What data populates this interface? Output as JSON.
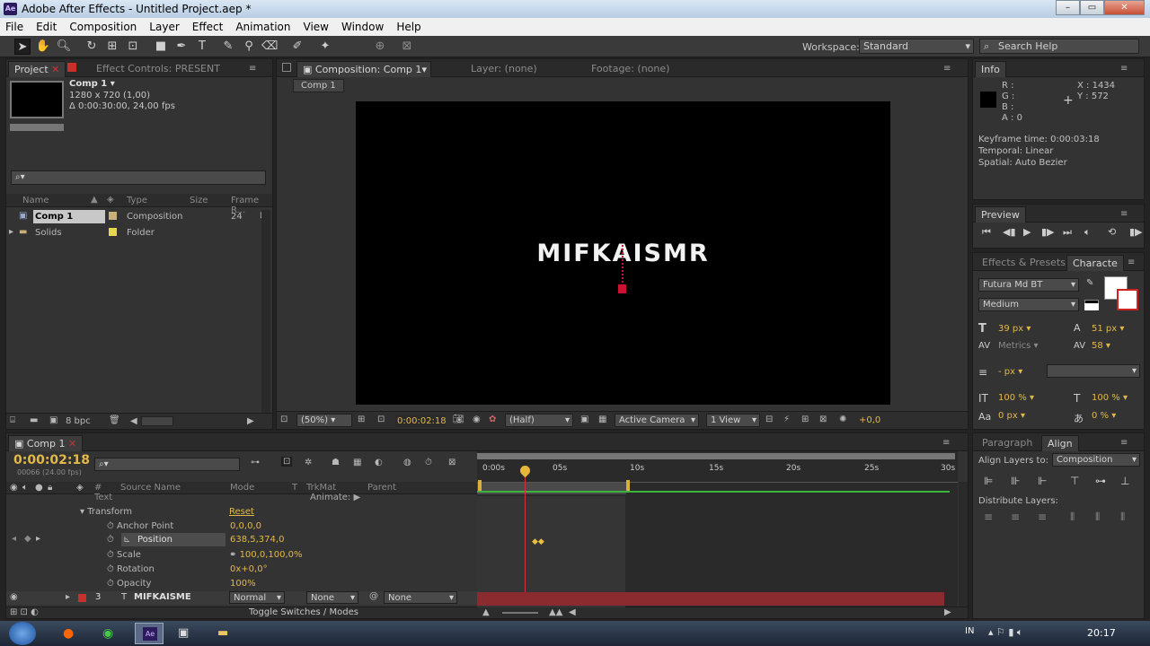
{
  "window": {
    "title": "Adobe After Effects - Untitled Project.aep *",
    "logo": "Ae",
    "min": "–",
    "max": "▭",
    "close": "✕"
  },
  "menu": [
    "File",
    "Edit",
    "Composition",
    "Layer",
    "Effect",
    "Animation",
    "View",
    "Window",
    "Help"
  ],
  "toolbar": {
    "workspace_label": "Workspace:",
    "workspace_value": "Standard",
    "search_placeholder": "Search Help"
  },
  "project": {
    "tab_project": "Project",
    "tab_effect": "Effect Controls: PRESENT",
    "comp_name": "Comp 1 ▾",
    "comp_size": "1280 x 720 (1,00)",
    "comp_duration": "Δ 0:00:30:00, 24,00 fps",
    "search_placeholder": "",
    "headers": {
      "name": "Name",
      "type": "Type",
      "size": "Size",
      "framerate": "Frame R..."
    },
    "items": [
      {
        "name": "Comp 1",
        "type": "Composition",
        "framerate": "24"
      },
      {
        "name": "Solids",
        "type": "Folder",
        "framerate": ""
      }
    ],
    "bpc": "8 bpc"
  },
  "composition": {
    "tab": "Composition: Comp 1",
    "layer_tab": "Layer: (none)",
    "footage_tab": "Footage: (none)",
    "crumb": "Comp 1",
    "canvas_text": "MIFKAISMR",
    "zoom": "(50%)",
    "timecode": "0:00:02:18",
    "resolution": "(Half)",
    "camera": "Active Camera",
    "view": "1 View",
    "exposure": "+0,0"
  },
  "info": {
    "tab": "Info",
    "r": "R :",
    "g": "G :",
    "b": "B :",
    "a": "A : 0",
    "x": "X : 1434",
    "y": "Y : 572",
    "keyframe_time": "Keyframe time: 0:00:03:18",
    "temporal": "Temporal: Linear",
    "spatial": "Spatial: Auto Bezier"
  },
  "preview": {
    "tab": "Preview"
  },
  "character": {
    "tab_effects": "Effects & Presets",
    "tab_char": "Characte",
    "font": "Futura Md BT",
    "style": "Medium",
    "size": "39",
    "size_unit": "px",
    "leading": "51",
    "leading_unit": "px",
    "kerning": "Metrics",
    "tracking": "58",
    "stroke": "- px",
    "vscale": "100 %",
    "hscale": "100 %",
    "baseline": "0 px",
    "tsume": "0 %"
  },
  "align": {
    "tab_paragraph": "Paragraph",
    "tab_align": "Align",
    "align_to_label": "Align Layers to:",
    "align_to_value": "Composition",
    "distribute_label": "Distribute Layers:"
  },
  "timeline": {
    "tab": "Comp 1",
    "timecode": "0:00:02:18",
    "frames": "00066 (24.00 fps)",
    "ruler": [
      "0:00s",
      "05s",
      "10s",
      "15s",
      "20s",
      "25s",
      "30s"
    ],
    "col_source": "Source Name",
    "col_mode": "Mode",
    "col_t": "T",
    "col_trkmat": "TrkMat",
    "col_parent": "Parent",
    "col_hash": "#",
    "animate": "Animate:",
    "rows": [
      {
        "name": "Text",
        "value": ""
      },
      {
        "name": "Transform",
        "value": "Reset"
      },
      {
        "name": "Anchor Point",
        "value": "0,0,0,0"
      },
      {
        "name": "Position",
        "value": "638,5,374,0"
      },
      {
        "name": "Scale",
        "value": "100,0,100,0%"
      },
      {
        "name": "Rotation",
        "value": "0x+0,0°"
      },
      {
        "name": "Opacity",
        "value": "100%"
      }
    ],
    "layer": {
      "num": "3",
      "name": "MIFKAISME",
      "mode": "Normal",
      "trkmat": "None",
      "parent": "None"
    },
    "toggle": "Toggle Switches / Modes"
  },
  "taskbar": {
    "lang": "IN",
    "time": "20:17"
  }
}
